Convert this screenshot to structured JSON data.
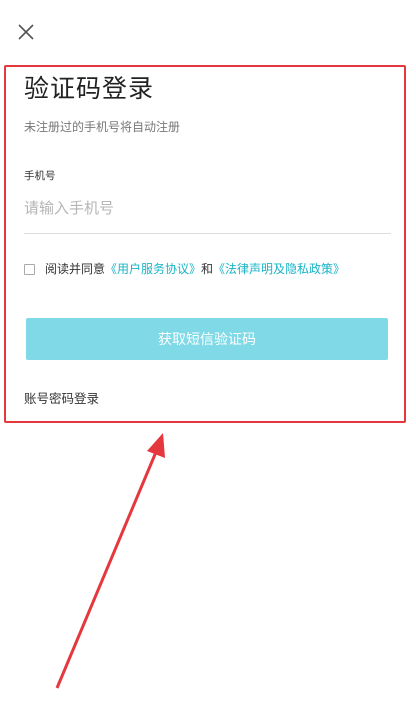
{
  "header": {
    "close_icon": "close-icon"
  },
  "login": {
    "title": "验证码登录",
    "subtitle": "未注册过的手机号将自动注册",
    "phone_label": "手机号",
    "phone_placeholder": "请输入手机号",
    "phone_value": ""
  },
  "agreement": {
    "checked": false,
    "prefix": "阅读并同意",
    "user_agreement": "《用户服务协议》",
    "conjunction": "和",
    "privacy_policy": "《法律声明及隐私政策》"
  },
  "actions": {
    "get_code_label": "获取短信验证码",
    "password_login_label": "账号密码登录"
  },
  "colors": {
    "accent": "#19b4c6",
    "button_disabled": "#7fd9e6",
    "annotation": "#e5383e"
  }
}
